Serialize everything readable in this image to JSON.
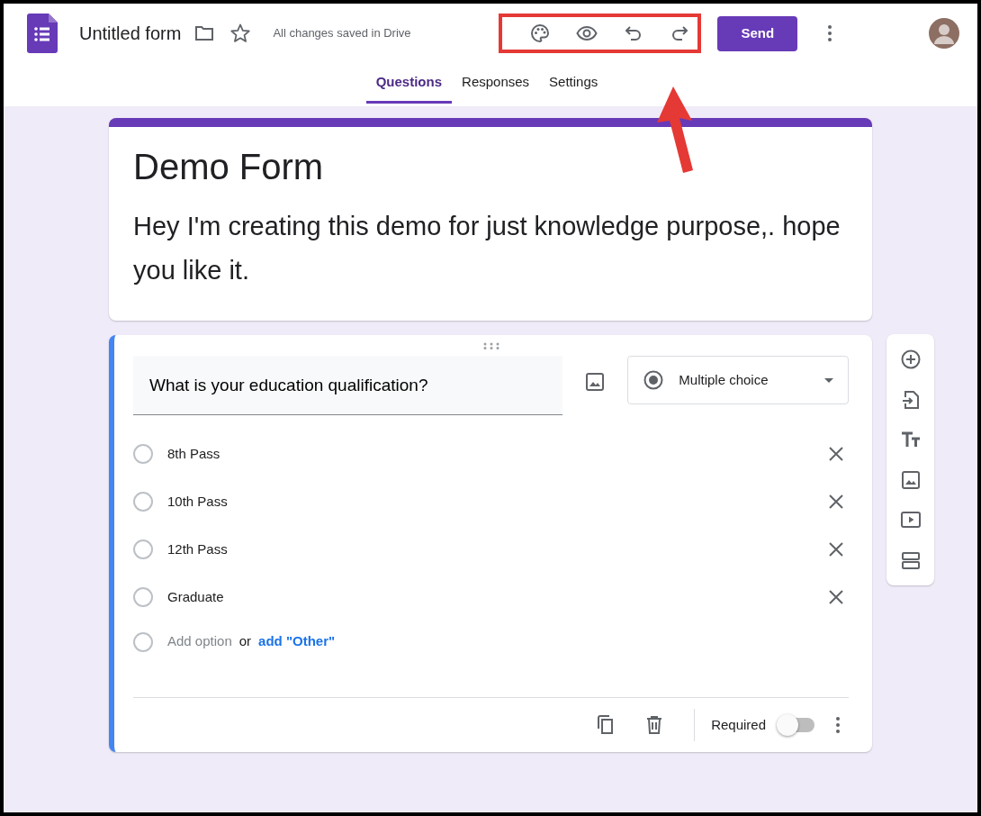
{
  "header": {
    "title": "Untitled form",
    "save_status": "All changes saved in Drive",
    "send_button": "Send"
  },
  "tabs": [
    {
      "label": "Questions",
      "selected": true
    },
    {
      "label": "Responses",
      "selected": false
    },
    {
      "label": "Settings",
      "selected": false
    }
  ],
  "form": {
    "title": "Demo Form",
    "description": "Hey I'm creating this demo for just knowledge purpose,. hope you like it."
  },
  "question": {
    "text": "What is your education qualification?",
    "type": "Multiple choice",
    "options": [
      "8th Pass",
      "10th Pass",
      "12th Pass",
      "Graduate"
    ],
    "add_option": "Add option",
    "or": "or",
    "add_other": "add \"Other\"",
    "required_label": "Required",
    "required": false
  }
}
